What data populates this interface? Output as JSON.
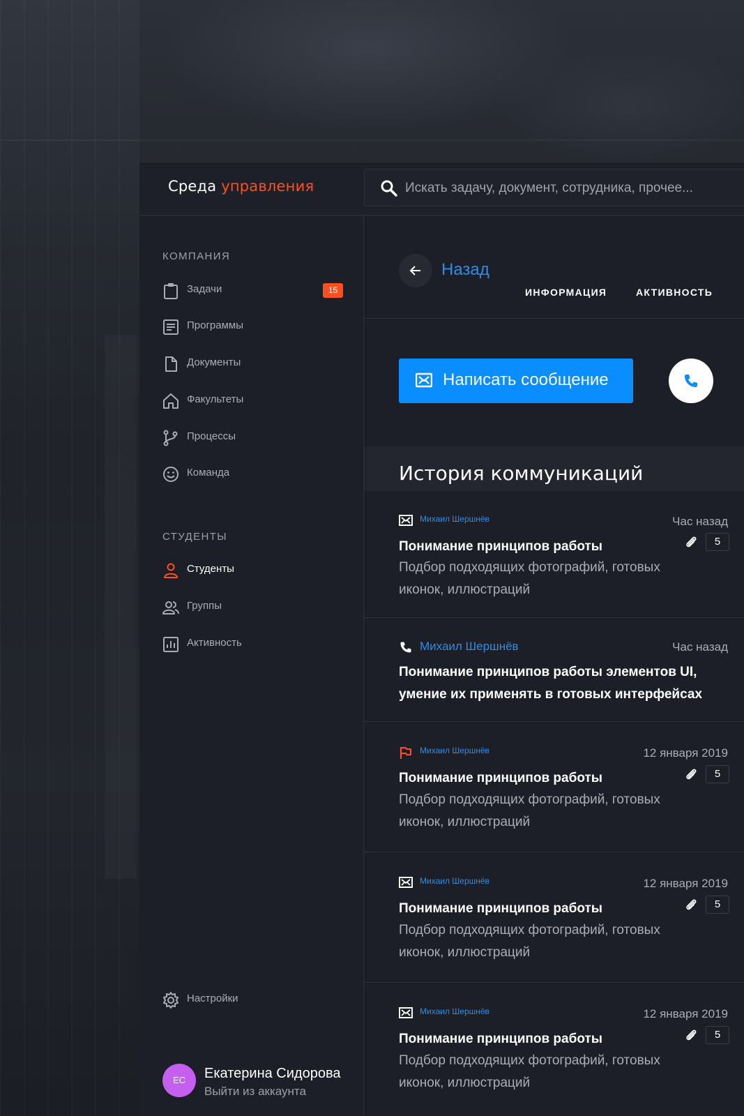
{
  "header": {
    "logo_main": "Среда",
    "logo_accent": "управления",
    "search_placeholder": "Искать задачу, документ, сотрудника, прочее..."
  },
  "sidebar": {
    "company_title": "КОМПАНИЯ",
    "company_items": [
      {
        "label": "Задачи",
        "icon": "clipboard-icon",
        "badge": "15"
      },
      {
        "label": "Программы",
        "icon": "list-document-icon"
      },
      {
        "label": "Документы",
        "icon": "file-icon"
      },
      {
        "label": "Факультеты",
        "icon": "home-icon"
      },
      {
        "label": "Процессы",
        "icon": "branch-icon"
      },
      {
        "label": "Команда",
        "icon": "smile-icon"
      }
    ],
    "students_title": "СТУДЕНТЫ",
    "student_items": [
      {
        "label": "Студенты",
        "icon": "person-icon",
        "active": true
      },
      {
        "label": "Группы",
        "icon": "group-icon"
      },
      {
        "label": "Активность",
        "icon": "chart-icon"
      }
    ],
    "settings_label": "Настройки",
    "user": {
      "initials": "ЕС",
      "name": "Екатерина Сидорова",
      "logout": "Выйти из аккаунта"
    }
  },
  "main": {
    "back_label": "Назад",
    "tabs": [
      "ИНФОРМАЦИЯ",
      "АКТИВНОСТЬ"
    ],
    "write_message": "Написать сообщение",
    "history_title": "История коммуникаций",
    "feed": [
      {
        "type": "mail",
        "author": "Михаил Шершнёв",
        "time": "Час назад",
        "title": "Понимание принципов работы",
        "desc": "Подбор подходящих фотографий, готовых иконок, иллюстраций",
        "attachments": "5"
      },
      {
        "type": "call",
        "author": "Михаил Шершнёв",
        "time": "Час назад",
        "title_line1": "Понимание принципов работы элементов UI,",
        "title_line2": "умение их применять в готовых интерфейсах"
      },
      {
        "type": "flag",
        "author": "Михаил Шершнёв",
        "time": "12 января 2019",
        "title": "Понимание принципов работы",
        "desc": "Подбор подходящих фотографий, готовых иконок, иллюстраций",
        "attachments": "5"
      },
      {
        "type": "mail",
        "author": "Михаил Шершнёв",
        "time": "12 января 2019",
        "title": "Понимание принципов работы",
        "desc": "Подбор подходящих фотографий, готовых иконок, иллюстраций",
        "attachments": "5"
      },
      {
        "type": "mail",
        "author": "Михаил Шершнёв",
        "time": "12 января 2019",
        "title": "Понимание принципов работы",
        "desc": "Подбор подходящих фотографий, готовых иконок, иллюстраций",
        "attachments": "5"
      }
    ]
  },
  "colors": {
    "accent_orange": "#ff4f1f",
    "primary_blue": "#0a8dff",
    "link_blue": "#2d8de6",
    "avatar_purple": "#c55ff0"
  }
}
